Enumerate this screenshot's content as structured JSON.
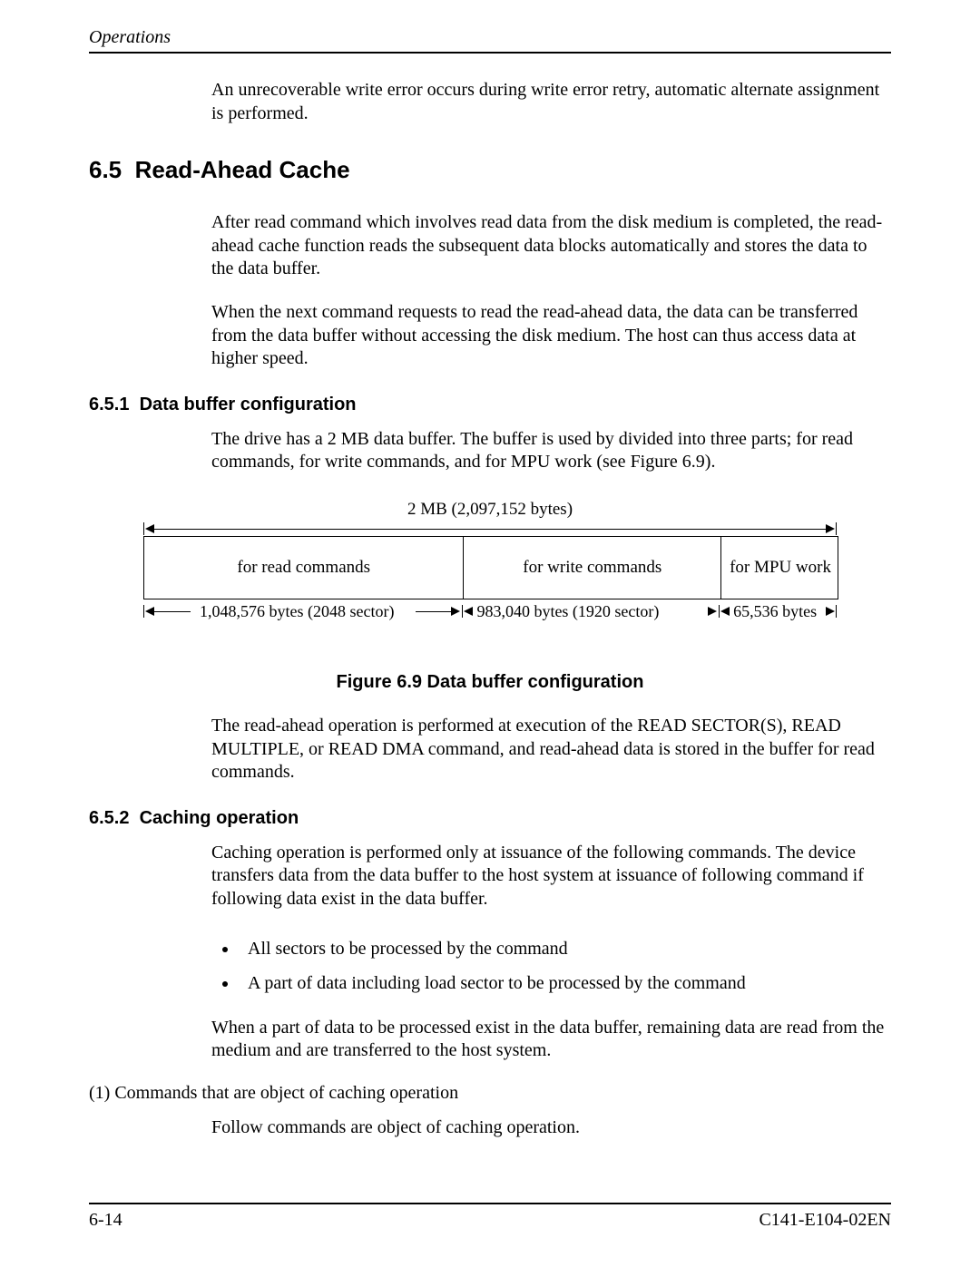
{
  "header": {
    "section": "Operations"
  },
  "intro_para": "An unrecoverable write error occurs during write error retry, automatic alternate assignment is performed.",
  "h2": {
    "num": "6.5",
    "title": "Read-Ahead Cache"
  },
  "p1": "After read command which involves read data from the disk medium is completed, the read-ahead cache function reads the subsequent data blocks automatically and stores the data to the data buffer.",
  "p2": "When the next command requests to read the read-ahead data, the data can be transferred from the data buffer without accessing the disk medium.  The host can thus access data at higher speed.",
  "s651": {
    "num": "6.5.1",
    "title": "Data buffer configuration"
  },
  "p3": "The drive has a 2 MB data buffer.  The buffer is used by divided into three parts; for read commands, for write commands, and for MPU work (see Figure 6.9).",
  "diagram": {
    "total_label": "2 MB (2,097,152 bytes)",
    "seg_read": "for read commands",
    "seg_write": "for write commands",
    "seg_mpu": "for MPU work",
    "dim_read": "1,048,576 bytes (2048 sector)",
    "dim_write": "983,040 bytes (1920 sector)",
    "dim_mpu": "65,536 bytes"
  },
  "figure_caption": "Figure 6.9  Data buffer configuration",
  "p4": "The read-ahead operation is performed at execution of the READ SECTOR(S), READ MULTIPLE, or READ DMA command, and read-ahead data is stored in the buffer for read commands.",
  "s652": {
    "num": "6.5.2",
    "title": "Caching operation"
  },
  "p5": "Caching operation is performed only at issuance of the following commands.  The device transfers data from the data buffer to the host system at issuance of following command if following data exist in the data buffer.",
  "bullets": {
    "b1": "All sectors to be processed by the command",
    "b2": "A part of data including load sector to be processed by the command"
  },
  "p6": "When a part of data to be processed exist in the data buffer, remaining data are read from the medium and are transferred to the host system.",
  "numitem": "(1)   Commands that are object of caching operation",
  "p7": "Follow commands are object of caching operation.",
  "footer": {
    "left": "6-14",
    "right": "C141-E104-02EN"
  }
}
